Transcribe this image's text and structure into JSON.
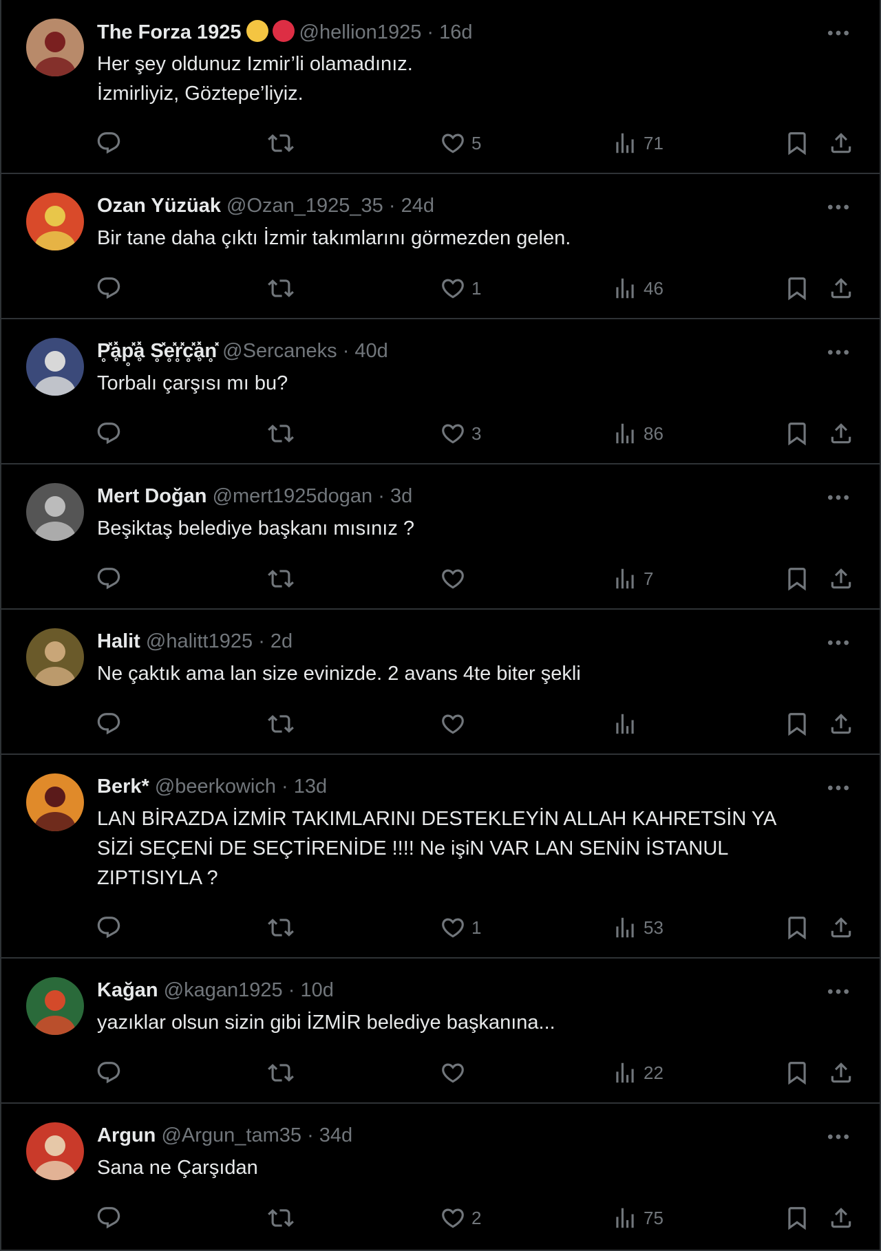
{
  "replies": [
    {
      "name": "The Forza 1925",
      "badges": [
        "yellow-circle",
        "red-circle"
      ],
      "handle": "@hellion1925",
      "dot": "·",
      "time": "16d",
      "text": "Her şey oldunuz Izmir’li olamadınız.\nİzmirliyiz, Göztepe’liyiz.",
      "likes": "5",
      "views": "71",
      "colors": {
        "a": "#b88a6a",
        "b": "#7a2020"
      }
    },
    {
      "name": "Ozan Yüzüak",
      "handle": "@Ozan_1925_35",
      "dot": "·",
      "time": "24d",
      "text": "Bir tane daha çıktı İzmir takımlarını görmezden gelen.",
      "likes": "1",
      "views": "46",
      "colors": {
        "a": "#d94a2a",
        "b": "#e8c64a"
      }
    },
    {
      "name": "P̥̽ḁ̽p̥̽ḁ̽ S̥̽e̥̽r̥̽c̥̽ḁ̽n̥̽",
      "handle": "@Sercaneks",
      "dot": "·",
      "time": "40d",
      "text": "Torbalı çarşısı mı bu?",
      "likes": "3",
      "views": "86",
      "colors": {
        "a": "#3b4a7a",
        "b": "#d8d8d8"
      }
    },
    {
      "name": "Mert Doğan",
      "handle": "@mert1925dogan",
      "dot": "·",
      "time": "3d",
      "text": "Beşiktaş belediye başkanı mısınız ?",
      "likes": "",
      "views": "7",
      "colors": {
        "a": "#555555",
        "b": "#bbbbbb"
      }
    },
    {
      "name": "Halit",
      "handle": "@halitt1925",
      "dot": "·",
      "time": "2d",
      "text": "Ne çaktık ama lan size evinizde. 2 avans 4te biter şekli",
      "likes": "",
      "views": "",
      "colors": {
        "a": "#6a5a2a",
        "b": "#c9a678"
      }
    },
    {
      "name": "Berk*",
      "handle": "@beerkowich",
      "dot": "·",
      "time": "13d",
      "text": "LAN BİRAZDA İZMİR TAKIMLARINI DESTEKLEYİN ALLAH KAHRETSİN YA\nSİZİ SEÇENİ DE SEÇTİRENİDE !!!! Ne işiN VAR LAN SENİN İSTANUL\nZIPTISIYLA ?",
      "likes": "1",
      "views": "53",
      "colors": {
        "a": "#e08a2a",
        "b": "#5a1a1a"
      }
    },
    {
      "name": "Kağan",
      "handle": "@kagan1925",
      "dot": "·",
      "time": "10d",
      "text": "yazıklar olsun sizin gibi İZMİR belediye başkanına...",
      "likes": "",
      "views": "22",
      "colors": {
        "a": "#2a6a3a",
        "b": "#d44a2a"
      }
    },
    {
      "name": "Argun",
      "handle": "@Argun_tam35",
      "dot": "·",
      "time": "34d",
      "text": "Sana ne Çarşıdan",
      "likes": "2",
      "views": "75",
      "colors": {
        "a": "#c93a2a",
        "b": "#e6c8a8"
      }
    }
  ]
}
